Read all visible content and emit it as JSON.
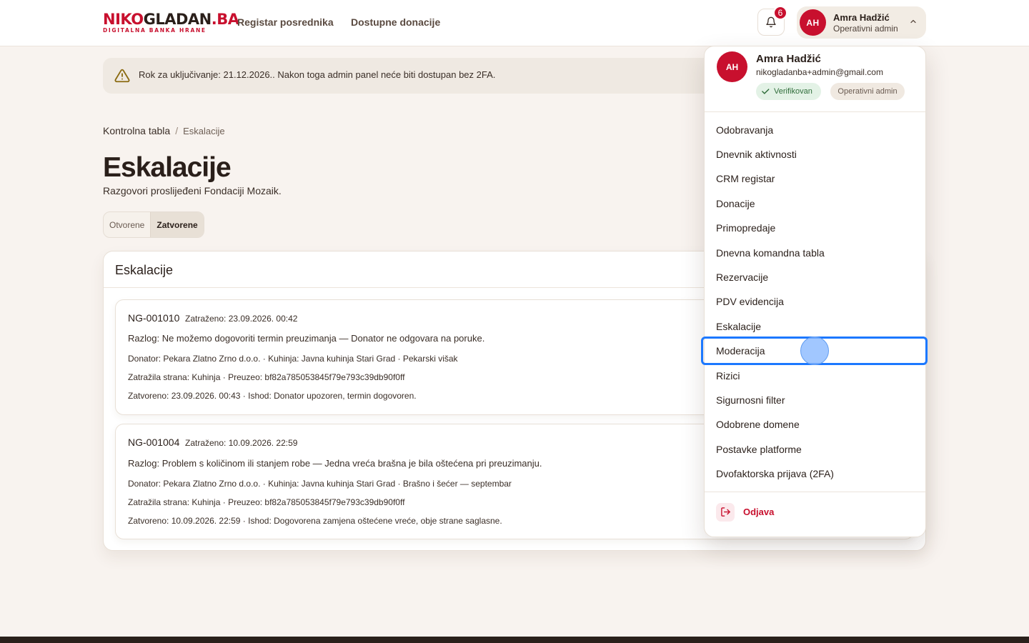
{
  "logo": {
    "main_red": "NIKO",
    "main_dark": "GLADAN",
    "main_tail": ".BA",
    "subtitle": "DIGITALNA BANKA HRANE"
  },
  "nav": {
    "link_1": "Registar posrednika",
    "link_2": "Dostupne donacije"
  },
  "notifications": {
    "count": "6",
    "icon": "bell-icon"
  },
  "user": {
    "initials": "AH",
    "name": "Amra Hadžić",
    "role": "Operativni admin",
    "email": "nikogladanba+admin@gmail.com",
    "verified": "Verifikovan"
  },
  "warning": {
    "text": "Rok za uključivanje: 21.12.2026.. Nakon toga admin panel neće biti dostupan bez 2FA.",
    "icon": "warning-triangle-icon"
  },
  "breadcrumb": {
    "root": "Kontrolna tabla",
    "separator": "/",
    "current": "Eskalacije"
  },
  "page": {
    "title": "Eskalacije",
    "subtitle": "Razgovori proslijeđeni Fondaciji Mozaik."
  },
  "tabs": {
    "open": "Otvorene",
    "closed": "Zatvorene",
    "selected": "Zatvorene"
  },
  "panel": {
    "title": "Eskalacije",
    "cards": [
      {
        "id": "NG-001010",
        "requested": "Zatraženo: 23.09.2026. 00:42",
        "reason": "Razlog: Ne možemo dogovoriti termin preuzimanja — Donator ne odgovara na poruke.",
        "parties": "Donator: Pekara Zlatno Zrno d.o.o. · Kuhinja: Javna kuhinja Stari Grad · Pekarski višak",
        "requester": "Zatražila strana: Kuhinja · Preuzeo: bf82a785053845f79e793c39db90f0ff",
        "closed": "Zatvoreno: 23.09.2026. 00:43 · Ishod: Donator upozoren, termin dogovoren."
      },
      {
        "id": "NG-001004",
        "requested": "Zatraženo: 10.09.2026. 22:59",
        "reason": "Razlog: Problem s količinom ili stanjem robe — Jedna vreća brašna je bila oštećena pri preuzimanju.",
        "parties": "Donator: Pekara Zlatno Zrno d.o.o. · Kuhinja: Javna kuhinja Stari Grad · Brašno i šećer — septembar",
        "requester": "Zatražila strana: Kuhinja · Preuzeo: bf82a785053845f79e793c39db90f0ff",
        "closed": "Zatvoreno: 10.09.2026. 22:59 · Ishod: Dogovorena zamjena oštećene vreće, obje strane saglasne."
      }
    ]
  },
  "menu": {
    "items": [
      "Odobravanja",
      "Dnevnik aktivnosti",
      "CRM registar",
      "Donacije",
      "Primopredaje",
      "Dnevna komandna tabla",
      "Rezervacije",
      "PDV evidencija",
      "Eskalacije",
      "Moderacija",
      "Rizici",
      "Sigurnosni filter",
      "Odobrene domene",
      "Postavke platforme",
      "Dvofaktorska prijava (2FA)"
    ],
    "highlighted": "Moderacija",
    "logout": "Odjava"
  },
  "colors": {
    "brand": "#c8102e",
    "background": "#f8f3ef",
    "focus": "#1c78ff",
    "verified": "#2f6d3a"
  }
}
